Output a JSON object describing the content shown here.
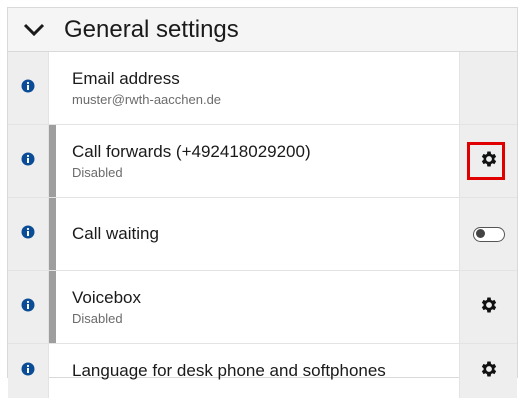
{
  "section": {
    "title": "General settings"
  },
  "rows": [
    {
      "label": "Email address",
      "sub": "muster@rwth-aacchen.de"
    },
    {
      "label": "Call forwards (+492418029200)",
      "sub": "Disabled"
    },
    {
      "label": "Call waiting",
      "toggle_state": "off"
    },
    {
      "label": "Voicebox",
      "sub": "Disabled"
    },
    {
      "label": "Language for desk phone and softphones"
    }
  ],
  "colors": {
    "info_icon": "#0a4c96",
    "highlight": "#e00000",
    "active_bar": "#9e9e9e"
  }
}
